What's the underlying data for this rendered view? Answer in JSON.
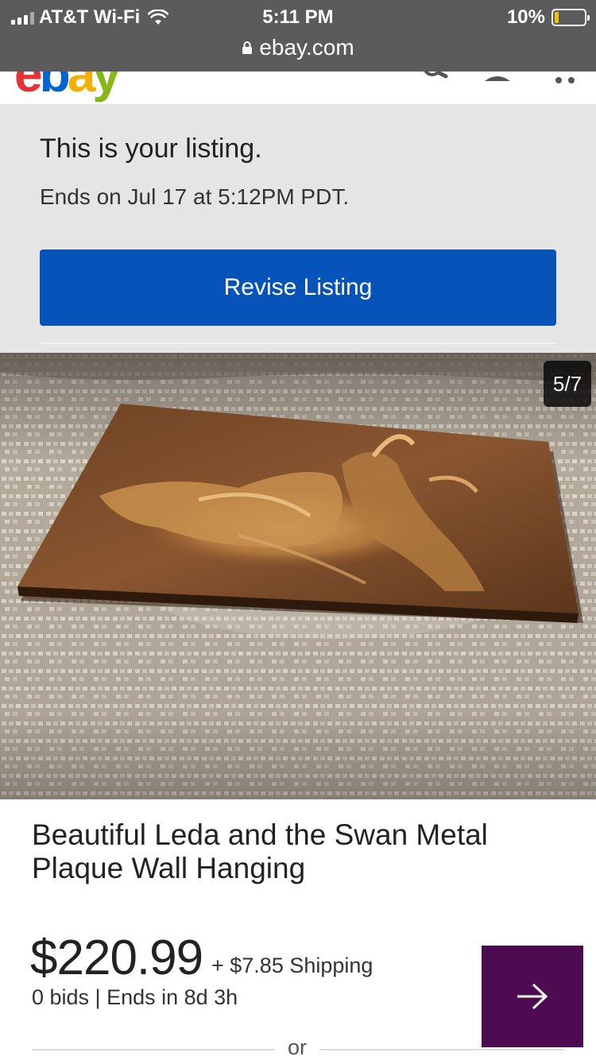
{
  "status_bar": {
    "carrier": "AT&T Wi-Fi",
    "time": "5:11 PM",
    "battery": "10%",
    "battery_level": 0.1,
    "url": "ebay.com"
  },
  "header": {
    "logo_letters": [
      "e",
      "b",
      "a",
      "y"
    ],
    "icons": [
      "search-icon",
      "user-icon",
      "cart-icon"
    ]
  },
  "banner": {
    "heading": "This is your listing.",
    "ends_text": "Ends on Jul 17 at 5:12PM PDT.",
    "revise_label": "Revise Listing",
    "button_color": "#0654ba"
  },
  "photo": {
    "counter": "5/7"
  },
  "item": {
    "title": "Beautiful Leda and the Swan Metal Plaque Wall Hanging",
    "price": "$220.99",
    "shipping": "+ $7.85 Shipping",
    "bids_info": "0 bids | Ends in 8d 3h",
    "action_color": "#4d0b51"
  },
  "divider_label": "or"
}
